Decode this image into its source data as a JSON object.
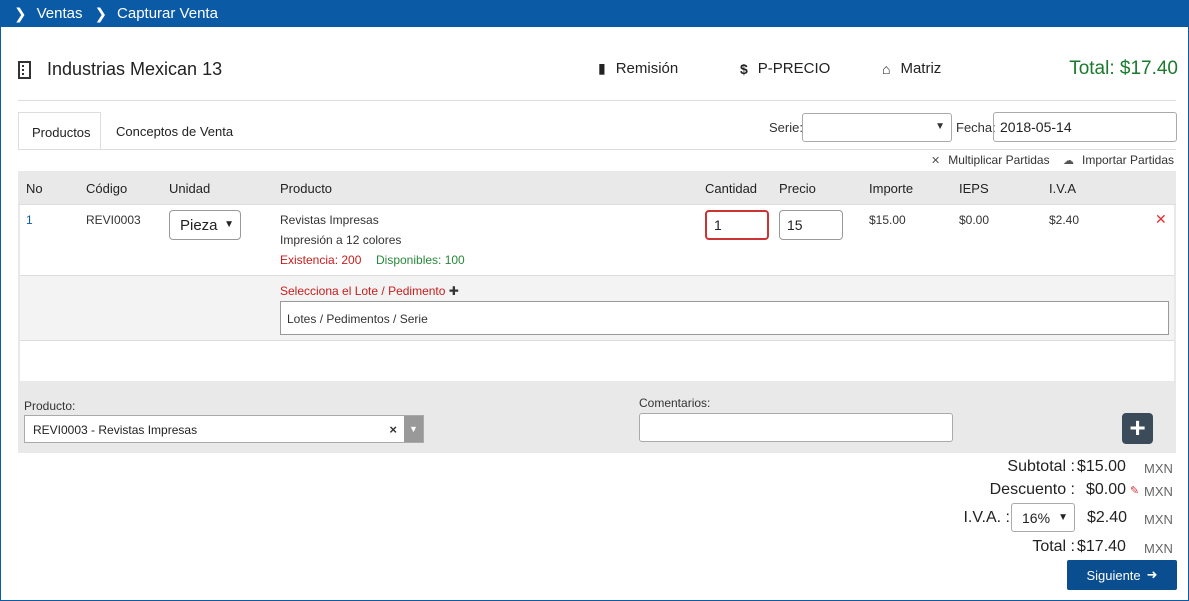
{
  "breadcrumb": {
    "items": [
      "Ventas",
      "Capturar Venta"
    ]
  },
  "header": {
    "company": "Industrias Mexican 13",
    "links": [
      {
        "label": "Remisión",
        "icon": "document-icon"
      },
      {
        "label": "P-PRECIO",
        "icon": "dollar-icon"
      },
      {
        "label": "Matriz",
        "icon": "home-icon"
      }
    ],
    "total": "Total: $17.40"
  },
  "tabs": [
    {
      "label": "Productos",
      "active": true
    },
    {
      "label": "Conceptos de Venta",
      "active": false
    }
  ],
  "filters": {
    "serie_label": "Serie:",
    "serie_value": "",
    "fecha_label": "Fecha:",
    "fecha_value": "2018-05-14"
  },
  "actions": {
    "multiplicar": "Multiplicar Partidas",
    "importar": "Importar Partidas"
  },
  "table": {
    "headers": [
      "No",
      "Código",
      "Unidad",
      "Producto",
      "Cantidad",
      "Precio",
      "Importe",
      "IEPS",
      "I.V.A"
    ],
    "rows": [
      {
        "no": "1",
        "codigo": "REVI0003",
        "unidad": "Pieza",
        "producto": "Revistas Impresas",
        "descripcion": "Impresión a 12 colores",
        "existencia": "Existencia: 200",
        "disponibles": "Disponibles: 100",
        "cantidad": "1",
        "precio": "15",
        "importe": "$15.00",
        "ieps": "$0.00",
        "iva": "$2.40"
      }
    ],
    "lote_label": "Selecciona el Lote / Pedimento",
    "lote_placeholder": "Lotes / Pedimentos / Serie"
  },
  "entry": {
    "producto_label": "Producto:",
    "producto_value": "REVI0003 - Revistas Impresas",
    "comentarios_label": "Comentarios:",
    "comentarios_value": ""
  },
  "summary": {
    "subtotal_label": "Subtotal :",
    "subtotal_value": "$15.00",
    "descuento_label": "Descuento :",
    "descuento_value": "$0.00",
    "iva_label": "I.V.A. :",
    "iva_rate": "16%",
    "iva_value": "$2.40",
    "total_label": "Total :",
    "total_value": "$17.40",
    "currency": "MXN"
  },
  "buttons": {
    "next": "Siguiente"
  },
  "colors": {
    "nav": "#0a5aa6",
    "total": "#1a7a2e",
    "button": "#0a4e8f",
    "error": "#c81d1d",
    "available": "#28883a"
  }
}
